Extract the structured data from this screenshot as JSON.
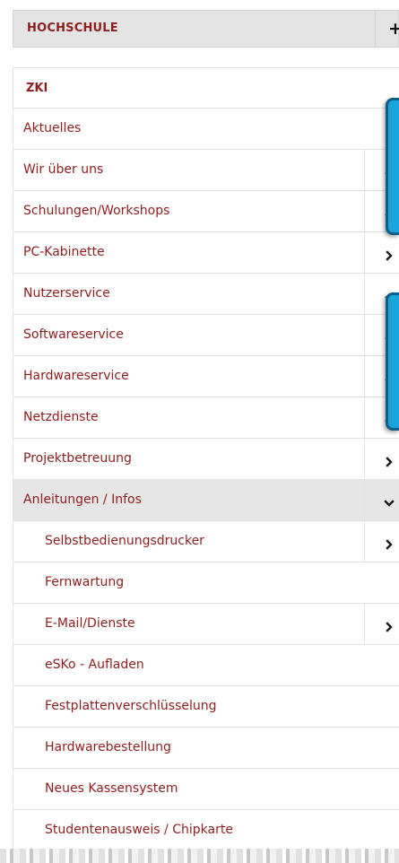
{
  "hochschule": {
    "label": "HOCHSCHULE",
    "toggle": "+"
  },
  "zki": {
    "label": "ZKI"
  },
  "menu": [
    {
      "label": "Aktuelles",
      "level": 1,
      "chevron": "none"
    },
    {
      "label": "Wir über uns",
      "level": 1,
      "chevron": "partial"
    },
    {
      "label": "Schulungen/Workshops",
      "level": 1,
      "chevron": "partial"
    },
    {
      "label": "PC-Kabinette",
      "level": 1,
      "chevron": "right"
    },
    {
      "label": "Nutzerservice",
      "level": 1,
      "chevron": "partial"
    },
    {
      "label": "Softwareservice",
      "level": 1,
      "chevron": "partial"
    },
    {
      "label": "Hardwareservice",
      "level": 1,
      "chevron": "partial"
    },
    {
      "label": "Netzdienste",
      "level": 1,
      "chevron": "partial"
    },
    {
      "label": "Projektbetreuung",
      "level": 1,
      "chevron": "right"
    },
    {
      "label": "Anleitungen / Infos",
      "level": 1,
      "chevron": "down",
      "active": true
    },
    {
      "label": "Selbstbedienungsdrucker",
      "level": 2,
      "chevron": "right"
    },
    {
      "label": "Fernwartung",
      "level": 2,
      "chevron": "none"
    },
    {
      "label": "E-Mail/Dienste",
      "level": 2,
      "chevron": "right"
    },
    {
      "label": "eSKo - Aufladen",
      "level": 2,
      "chevron": "none"
    },
    {
      "label": "Festplattenverschlüsselung",
      "level": 2,
      "chevron": "none"
    },
    {
      "label": "Hardwarebestellung",
      "level": 2,
      "chevron": "none"
    },
    {
      "label": "Neues Kassensystem",
      "level": 2,
      "chevron": "none"
    },
    {
      "label": "Studentenausweis / Chipkarte",
      "level": 2,
      "chevron": "none"
    }
  ],
  "colors": {
    "link": "#8e1e1e",
    "active_bg": "#e6e6e6",
    "header_bg": "#e4e4e4",
    "badge": "#1aa4dc"
  },
  "icons": {
    "toggle": "plus-icon",
    "right": "chevron-right-icon",
    "down": "chevron-down-icon"
  }
}
